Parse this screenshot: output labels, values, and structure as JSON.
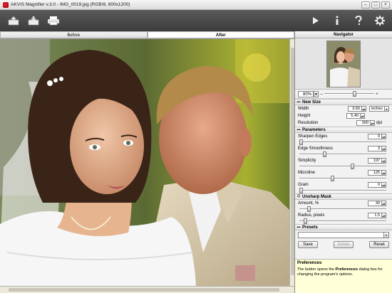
{
  "window": {
    "title": "AKVIS Magnifier v.3.0 - IMG_0019.jpg (RGB/8, 800x1200)",
    "controls": [
      "–",
      "□",
      "×"
    ]
  },
  "toolbar": {
    "left_icons": [
      "open-image-icon",
      "save-image-icon",
      "print-icon"
    ],
    "right_icons": [
      "run-icon",
      "info-icon",
      "help-icon",
      "preferences-icon"
    ]
  },
  "tabs": [
    {
      "label": "Before",
      "active": false
    },
    {
      "label": "After",
      "active": true
    }
  ],
  "navigator": {
    "title": "Navigator",
    "zoom": "80%",
    "zoom_minus": "–",
    "zoom_plus": "+"
  },
  "new_size": {
    "title": "New Size",
    "width_label": "Width",
    "width_value": "3.60",
    "height_label": "Height",
    "height_value": "5.40",
    "units": "inches",
    "resolution_label": "Resolution",
    "resolution_value": "300",
    "resolution_unit": "dpi"
  },
  "parameters": {
    "title": "Parameters",
    "items": [
      {
        "label": "Sharpen Edges",
        "value": "0",
        "level": 0.0
      },
      {
        "label": "Edge Smoothness",
        "value": "3",
        "level": 0.3
      },
      {
        "label": "Simplicity",
        "value": "197",
        "level": 0.65
      },
      {
        "label": "Microline",
        "value": "125",
        "level": 0.4
      },
      {
        "label": "Grain",
        "value": "0",
        "level": 0.0
      }
    ]
  },
  "unsharp_mask": {
    "title": "Unsharp Mask",
    "items": [
      {
        "label": "Amount, %",
        "value": "30",
        "level": 0.1
      },
      {
        "label": "Radius, pixels",
        "value": "1.5",
        "level": 0.05
      }
    ]
  },
  "presets": {
    "title": "Presets",
    "save_label": "Save",
    "delete_label": "Delete",
    "reset_label": "Reset"
  },
  "help": {
    "title": "Preferences",
    "text_before": "The button opens the ",
    "text_bold": "Preferences",
    "text_after": " dialog box for changing the program's options."
  },
  "colors": {
    "toolbar_bg": "#4a4a4a",
    "panel_bg": "#f2f2f2",
    "help_bg": "#ffffd8"
  }
}
